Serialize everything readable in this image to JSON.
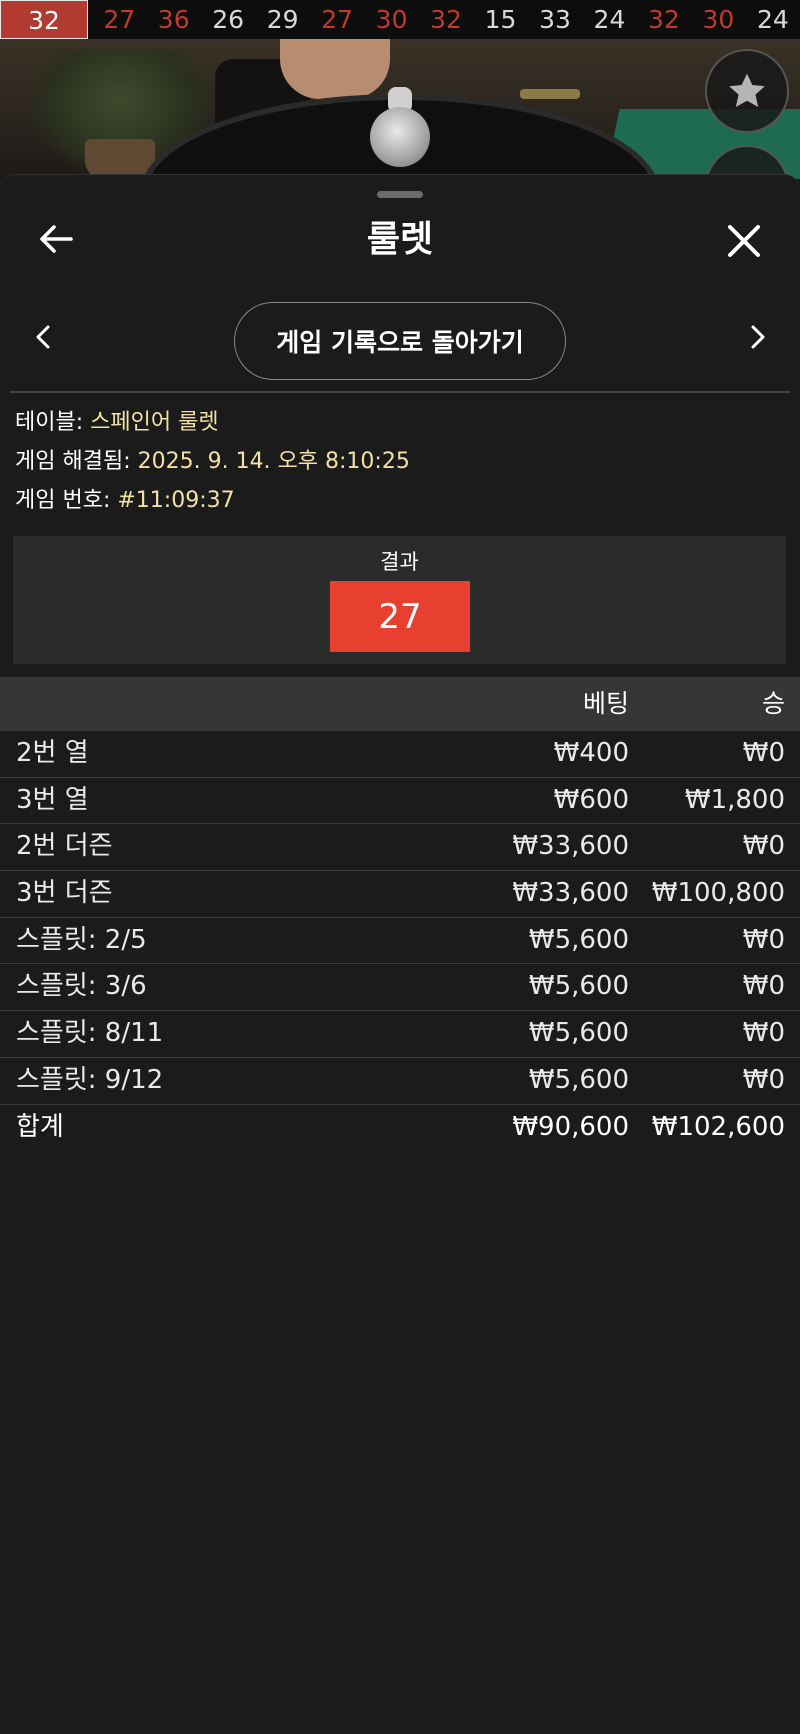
{
  "history": {
    "current": "32",
    "numbers": [
      {
        "value": "27",
        "color": "red"
      },
      {
        "value": "36",
        "color": "red"
      },
      {
        "value": "26",
        "color": "black"
      },
      {
        "value": "29",
        "color": "black"
      },
      {
        "value": "27",
        "color": "red"
      },
      {
        "value": "30",
        "color": "red"
      },
      {
        "value": "32",
        "color": "red"
      },
      {
        "value": "15",
        "color": "black"
      },
      {
        "value": "33",
        "color": "black"
      },
      {
        "value": "24",
        "color": "black"
      },
      {
        "value": "32",
        "color": "red"
      },
      {
        "value": "30",
        "color": "red"
      },
      {
        "value": "24",
        "color": "black"
      }
    ],
    "colors": {
      "red": "#c0392b",
      "black": "#d9d9d9",
      "current_bg": "#b23a31"
    }
  },
  "sheet": {
    "title": "룰렛",
    "back_icon": "arrow-left-icon",
    "close_icon": "close-icon",
    "nav": {
      "prev_icon": "chevron-left-icon",
      "next_icon": "chevron-right-icon",
      "back_to_history": "게임 기록으로 돌아가기"
    }
  },
  "info": {
    "table_label": "테이블:",
    "table_value": "스페인어 룰렛",
    "resolved_label": "게임 해결됨:",
    "resolved_value": "2025. 9. 14. 오후 8:10:25",
    "game_no_label": "게임 번호:",
    "game_no_value": "#11:09:37",
    "value_color": "#f2e2a6"
  },
  "result": {
    "label": "결과",
    "number": "27",
    "color": "#e84030"
  },
  "bets": {
    "headers": {
      "name": "",
      "bet": "베팅",
      "win": "승"
    },
    "rows": [
      {
        "name": "2번 열",
        "bet": "₩400",
        "win": "₩0"
      },
      {
        "name": "3번 열",
        "bet": "₩600",
        "win": "₩1,800"
      },
      {
        "name": "2번 더즌",
        "bet": "₩33,600",
        "win": "₩0"
      },
      {
        "name": "3번 더즌",
        "bet": "₩33,600",
        "win": "₩100,800"
      },
      {
        "name": "스플릿: 2/5",
        "bet": "₩5,600",
        "win": "₩0"
      },
      {
        "name": "스플릿: 3/6",
        "bet": "₩5,600",
        "win": "₩0"
      },
      {
        "name": "스플릿: 8/11",
        "bet": "₩5,600",
        "win": "₩0"
      },
      {
        "name": "스플릿: 9/12",
        "bet": "₩5,600",
        "win": "₩0"
      }
    ],
    "total": {
      "name": "합계",
      "bet": "₩90,600",
      "win": "₩102,600"
    }
  },
  "floating": {
    "favorite_icon": "star-icon"
  }
}
